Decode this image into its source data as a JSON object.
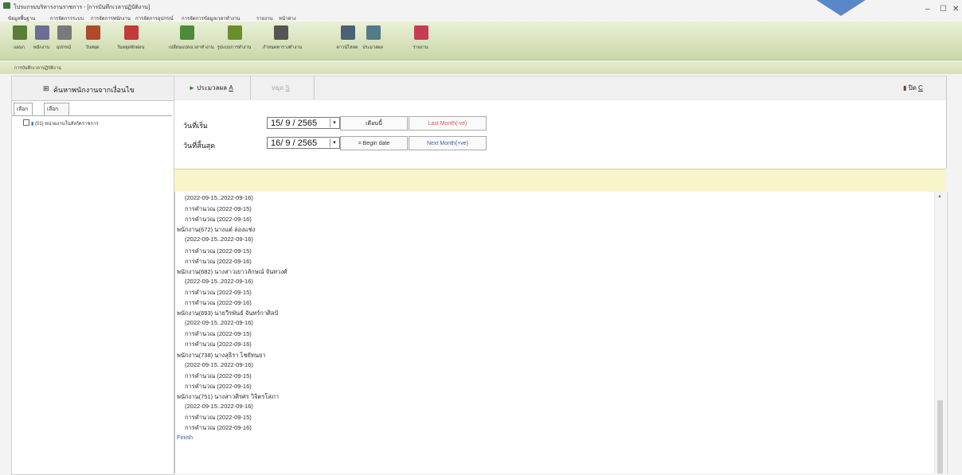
{
  "window": {
    "title": "โปรแกรมบริหารงานราชการ - [การบันทึกเวลาปฏิบัติงาน]",
    "controls": [
      "–",
      "☐",
      "✕"
    ]
  },
  "menu": [
    "ข้อมูลพื้นฐาน",
    "การจัดการระบบ",
    "การจัดการพนักงาน",
    "การจัดการอุปกรณ์",
    "การจัดการข้อมูลเวลาทำงาน",
    "รายงาน",
    "หน้าต่าง"
  ],
  "toolbar": [
    {
      "label": "แผนก",
      "icon": "department-icon",
      "color": "#5a7d3a"
    },
    {
      "label": "พนักงาน",
      "icon": "employee-icon",
      "color": "#6d6d9a"
    },
    {
      "label": "อุปกรณ์",
      "icon": "device-icon",
      "color": "#7a7a7a"
    },
    {
      "label": "วันหยุด",
      "icon": "holiday-icon",
      "color": "#b04a2a"
    },
    {
      "label": "วันหยุดพักผ่อน",
      "icon": "vacation-icon",
      "color": "#c23a3a"
    },
    {
      "label": "เปลี่ยนแปลงเวลาทำงาน",
      "icon": "shift-icon",
      "color": "#4d8a3c"
    },
    {
      "label": "รูปแบบการทำงาน",
      "icon": "work-pattern-icon",
      "color": "#6a8e2e"
    },
    {
      "label": "กำหนดตารางทำงาน",
      "icon": "schedule-icon",
      "color": "#555"
    },
    {
      "label": "ดาวน์โหลด",
      "icon": "download-icon",
      "color": "#4a6078"
    },
    {
      "label": "ประมวลผล",
      "icon": "process-icon",
      "color": "#557a88"
    },
    {
      "label": "รายงาน",
      "icon": "report-icon",
      "color": "#c83b57"
    }
  ],
  "doc_tab": "การบันทึกเวลาปฏิบัติงาน",
  "left": {
    "header": "ค้นหาพนักงานจากเงื่อนไข",
    "tabs": [
      "เลือกแผนก",
      "เลือกพนักงาน"
    ],
    "tree_item": "(01) หน่วยงานในสังกัดราชการ"
  },
  "toolbar_right": {
    "process": "ประมวลผล",
    "shortcut_process": "A",
    "stop": "หยุด",
    "stop_key": "S",
    "exit": "ปิด",
    "exit_key": "C"
  },
  "form": {
    "start_label": "วันที่เริ่ม",
    "end_label": "วันที่สิ้นสุด",
    "start_date": "15/ 9 / 2565",
    "end_date": "16/ 9 / 2565",
    "btn_this_month": "เดือนนี้",
    "btn_last_month": "Last Month(-ve)",
    "btn_begin_date": "= Begin date",
    "btn_next_month": "Next Month(+ve)"
  },
  "log": [
    {
      "indent": true,
      "text": "(2022-09-15..2022-09-16)"
    },
    {
      "indent": true,
      "text": "การคำนวณ (2022-09-15)"
    },
    {
      "indent": true,
      "text": "การคำนวณ (2022-09-16)"
    },
    {
      "indent": false,
      "text": "พนักงาน(672) นางแต๋ ล่องแช่ง"
    },
    {
      "indent": true,
      "text": "(2022-09-15..2022-09-16)"
    },
    {
      "indent": true,
      "text": "การคำนวณ (2022-09-15)"
    },
    {
      "indent": true,
      "text": "การคำนวณ (2022-09-16)"
    },
    {
      "indent": false,
      "text": "พนักงาน(682) นางสาวเยาวลักษณ์ จันทวงศ์"
    },
    {
      "indent": true,
      "text": "(2022-09-15..2022-09-16)"
    },
    {
      "indent": true,
      "text": "การคำนวณ (2022-09-15)"
    },
    {
      "indent": true,
      "text": "การคำนวณ (2022-09-16)"
    },
    {
      "indent": false,
      "text": "พนักงาน(693) นายวีรพันธ์ จันทร์กาศิลป์"
    },
    {
      "indent": true,
      "text": "(2022-09-15..2022-09-16)"
    },
    {
      "indent": true,
      "text": "การคำนวณ (2022-09-15)"
    },
    {
      "indent": true,
      "text": "การคำนวณ (2022-09-16)"
    },
    {
      "indent": false,
      "text": "พนักงาน(738) นางสุธิรา ไชยัทนยา"
    },
    {
      "indent": true,
      "text": "(2022-09-15..2022-09-16)"
    },
    {
      "indent": true,
      "text": "การคำนวณ (2022-09-15)"
    },
    {
      "indent": true,
      "text": "การคำนวณ (2022-09-16)"
    },
    {
      "indent": false,
      "text": "พนักงาน(751) นางสาวศิรศร วิจิตรโสภา"
    },
    {
      "indent": true,
      "text": "(2022-09-15..2022-09-16)"
    },
    {
      "indent": true,
      "text": "การคำนวณ (2022-09-15)"
    },
    {
      "indent": true,
      "text": "การคำนวณ (2022-09-16)"
    },
    {
      "indent": false,
      "text": "Finish",
      "color": "#3b4fa8"
    }
  ]
}
